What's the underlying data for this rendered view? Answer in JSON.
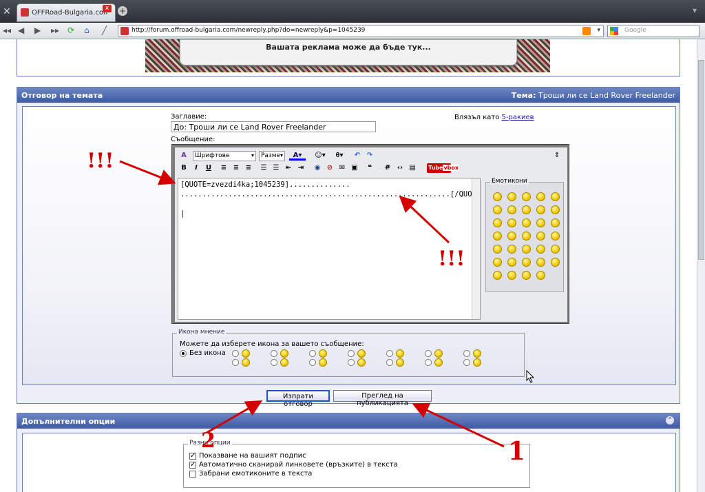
{
  "browser": {
    "tab_title": "OFFRoad-Bulgaria.com -...",
    "tab_close": "x",
    "new_tab": "+",
    "url": "http://forum.offroad-bulgaria.com/newreply.php?do=newreply&p=1045239",
    "search_placeholder": "Google"
  },
  "ad": {
    "text": "Вашата реклама може да бъде тук..."
  },
  "reply_panel": {
    "header": "Отговор на темата",
    "topic_label": "Тема:",
    "topic": "Троши ли се Land Rover Freelander",
    "title_label": "Заглавие:",
    "title_value": "До: Троши ли се  Land Rover Freelander",
    "logged_in_prefix": "Влязъл като",
    "username": "5-ракиев",
    "message_label": "Съобщение:",
    "font_select": "Шрифтове",
    "size_select": "Разме",
    "editor_text_line1": "[QUOTE=zvezdi4ka;1045239]..............",
    "editor_text_line2": "..............................................................[/QUOTE]",
    "emoticons_label": "Емотикони",
    "icon_legend": "Икона мнение",
    "icon_prompt": "Можете да изберете икона за вашето съобщение:",
    "no_icon_label": "Без икона"
  },
  "buttons": {
    "send": "Изпрати отговор",
    "preview": "Преглед на публикацията"
  },
  "options_panel": {
    "header": "Допълнителни опции",
    "legend": "Разни опции",
    "options": [
      {
        "label": "Показване на вашият подпис",
        "checked": true
      },
      {
        "label": "Автоматично сканирай линковете (връзките) в текста",
        "checked": true
      },
      {
        "label": "Забрани емотиконите в текста",
        "checked": false
      }
    ]
  },
  "annotations": {
    "exclaim_left": "!!!",
    "exclaim_right": "!!!",
    "num_1": "1",
    "num_2": "2"
  },
  "colors": {
    "header_blue": "#3d5aa3",
    "annotation_red": "#d40000"
  }
}
